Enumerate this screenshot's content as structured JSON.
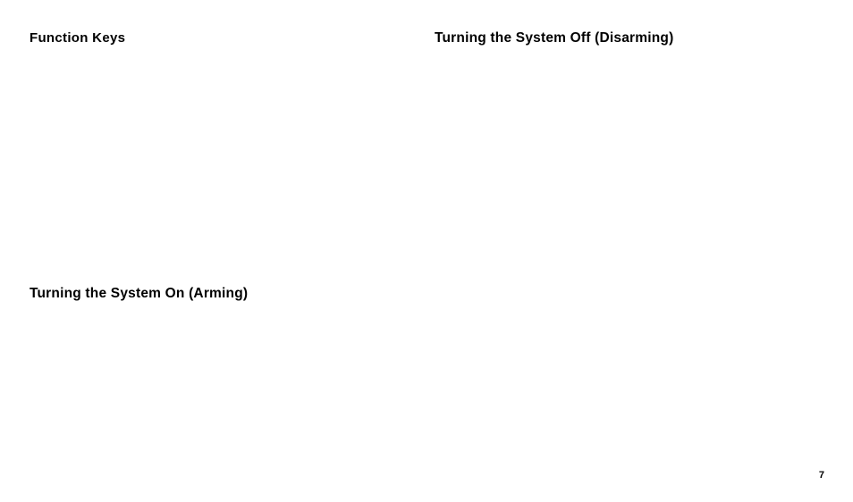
{
  "headings": {
    "function_keys": "Function  Keys",
    "arming": "Turning the System On (Arming)",
    "disarming": "Turning the System Off (Disarming)"
  },
  "page_number": "7"
}
